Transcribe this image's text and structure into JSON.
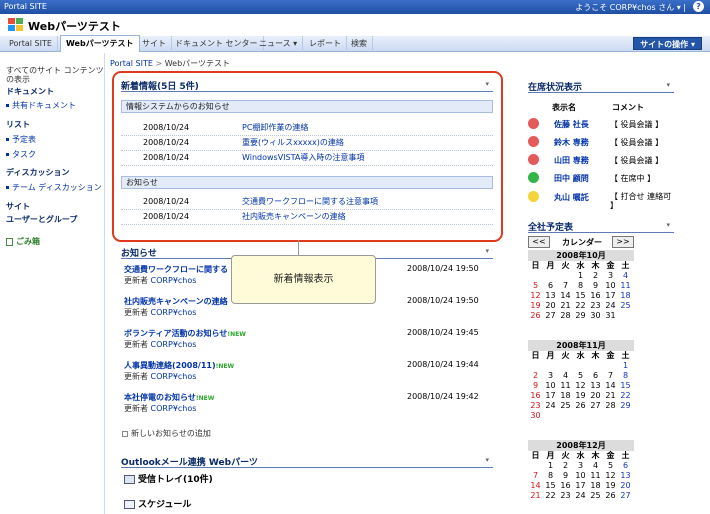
{
  "topbar": {
    "site": "Portal SITE",
    "welcome": "ようこそ CORP¥chos さん ▾ |",
    "help": "?"
  },
  "header": {
    "title": "Webパーツテスト"
  },
  "nav": {
    "tabs": [
      {
        "label": "Portal SITE"
      },
      {
        "label": "Webパーツテスト"
      },
      {
        "label": "サイト"
      },
      {
        "label": "ドキュメント センター"
      },
      {
        "label": "ニュース ▾"
      },
      {
        "label": "レポート"
      },
      {
        "label": "検索"
      }
    ],
    "actions": "サイトの操作 ▾"
  },
  "leftnav": {
    "all": "すべてのサイト コンテンツ\nの表示",
    "items": [
      {
        "label": "すべてのサイト コンテンツ",
        "type": "s2"
      },
      {
        "label": "の表示",
        "type": "s2"
      },
      {
        "label": "ドキュメント",
        "type": "h"
      },
      {
        "label": "共有ドキュメント",
        "type": "s"
      },
      {
        "label": "リスト",
        "type": "h"
      },
      {
        "label": "予定表",
        "type": "s"
      },
      {
        "label": "タスク",
        "type": "s"
      },
      {
        "label": "ディスカッション",
        "type": "h"
      },
      {
        "label": "チーム ディスカッション",
        "type": "s"
      },
      {
        "label": "サイト",
        "type": "h"
      },
      {
        "label": "ユーザーとグループ",
        "type": "h"
      }
    ],
    "recycle": "ごみ箱"
  },
  "breadcrumb": {
    "root": "Portal SITE",
    "sep": ">",
    "current": "Webパーツテスト"
  },
  "news_part": {
    "title": "新着情報(5日 5件)",
    "arrow": "▾",
    "groups": [
      {
        "label": "情報システムからのお知らせ",
        "rows": [
          {
            "date": "2008/10/24",
            "title": "PC棚卸作業の連絡"
          },
          {
            "date": "2008/10/24",
            "title": "重要(ウィルスxxxxx)の連絡"
          },
          {
            "date": "2008/10/24",
            "title": "WindowsVISTA導入時の注意事項"
          }
        ]
      },
      {
        "label": "お知らせ",
        "rows": [
          {
            "date": "2008/10/24",
            "title": "交通費ワークフローに関する注意事項"
          },
          {
            "date": "2008/10/24",
            "title": "社内販売キャンペーンの連絡"
          }
        ]
      }
    ]
  },
  "callout": "新着情報表示",
  "announce_part": {
    "title": "お知らせ",
    "arrow": "▾",
    "items": [
      {
        "title": "交通費ワークフローに関する",
        "new": "",
        "by": "更新者",
        "author": "CORP¥chos",
        "date": "2008/10/24 19:50"
      },
      {
        "title": "社内販売キャンペーンの連絡",
        "new": "",
        "by": "更新者",
        "author": "CORP¥chos",
        "date": "2008/10/24 19:50"
      },
      {
        "title": "ボランティア活動のお知らせ",
        "new": "!NEW",
        "by": "更新者",
        "author": "CORP¥chos",
        "date": "2008/10/24 19:45"
      },
      {
        "title": "人事異動連絡(2008/11)",
        "new": "!NEW",
        "by": "更新者",
        "author": "CORP¥chos",
        "date": "2008/10/24 19:44"
      },
      {
        "title": "本社停電のお知らせ",
        "new": "!NEW",
        "by": "更新者",
        "author": "CORP¥chos",
        "date": "2008/10/24 19:42"
      }
    ],
    "add": "新しいお知らせの追加"
  },
  "outlook_part": {
    "title": "Outlookメール連携 Webパーツ",
    "arrow": "▾",
    "inbox": "受信トレイ(10件)",
    "schedule": "スケジュール"
  },
  "presence": {
    "title": "在席状況表示",
    "arrow": "▾",
    "col_name": "表示名",
    "col_comment": "コメント",
    "rows": [
      {
        "name": "佐藤 社長",
        "comment": "【 役員会議 】",
        "color": "#e45a5a"
      },
      {
        "name": "鈴木 専務",
        "comment": "【 役員会議 】",
        "color": "#e45a5a"
      },
      {
        "name": "山田 専務",
        "comment": "【 役員会議 】",
        "color": "#e45a5a"
      },
      {
        "name": "田中 顧問",
        "comment": "【 在席中 】",
        "color": "#33b54a"
      },
      {
        "name": "丸山 嘱託",
        "comment": "【 打合せ 連絡可 】",
        "color": "#f5d33a"
      }
    ]
  },
  "calendar": {
    "title": "全社予定表",
    "arrow": "▾",
    "prev": "<<",
    "label": "カレンダー",
    "next": ">>",
    "weekdays": [
      "日",
      "月",
      "火",
      "水",
      "木",
      "金",
      "土"
    ],
    "months": [
      {
        "name": "2008年10月",
        "weeks": [
          [
            "",
            "",
            "",
            "1",
            "2",
            "3",
            "4"
          ],
          [
            "5",
            "6",
            "7",
            "8",
            "9",
            "10",
            "11"
          ],
          [
            "12",
            "13",
            "14",
            "15",
            "16",
            "17",
            "18"
          ],
          [
            "19",
            "20",
            "21",
            "22",
            "23",
            "24",
            "25"
          ],
          [
            "26",
            "27",
            "28",
            "29",
            "30",
            "31",
            ""
          ]
        ]
      },
      {
        "name": "2008年11月",
        "weeks": [
          [
            "",
            "",
            "",
            "",
            "",
            "",
            "1"
          ],
          [
            "2",
            "3",
            "4",
            "5",
            "6",
            "7",
            "8"
          ],
          [
            "9",
            "10",
            "11",
            "12",
            "13",
            "14",
            "15"
          ],
          [
            "16",
            "17",
            "18",
            "19",
            "20",
            "21",
            "22"
          ],
          [
            "23",
            "24",
            "25",
            "26",
            "27",
            "28",
            "29"
          ],
          [
            "30",
            "",
            "",
            "",
            "",
            "",
            ""
          ]
        ]
      },
      {
        "name": "2008年12月",
        "weeks": [
          [
            "",
            "1",
            "2",
            "3",
            "4",
            "5",
            "6"
          ],
          [
            "7",
            "8",
            "9",
            "10",
            "11",
            "12",
            "13"
          ],
          [
            "14",
            "15",
            "16",
            "17",
            "18",
            "19",
            "20"
          ],
          [
            "21",
            "22",
            "23",
            "24",
            "25",
            "26",
            "27"
          ]
        ]
      }
    ]
  }
}
